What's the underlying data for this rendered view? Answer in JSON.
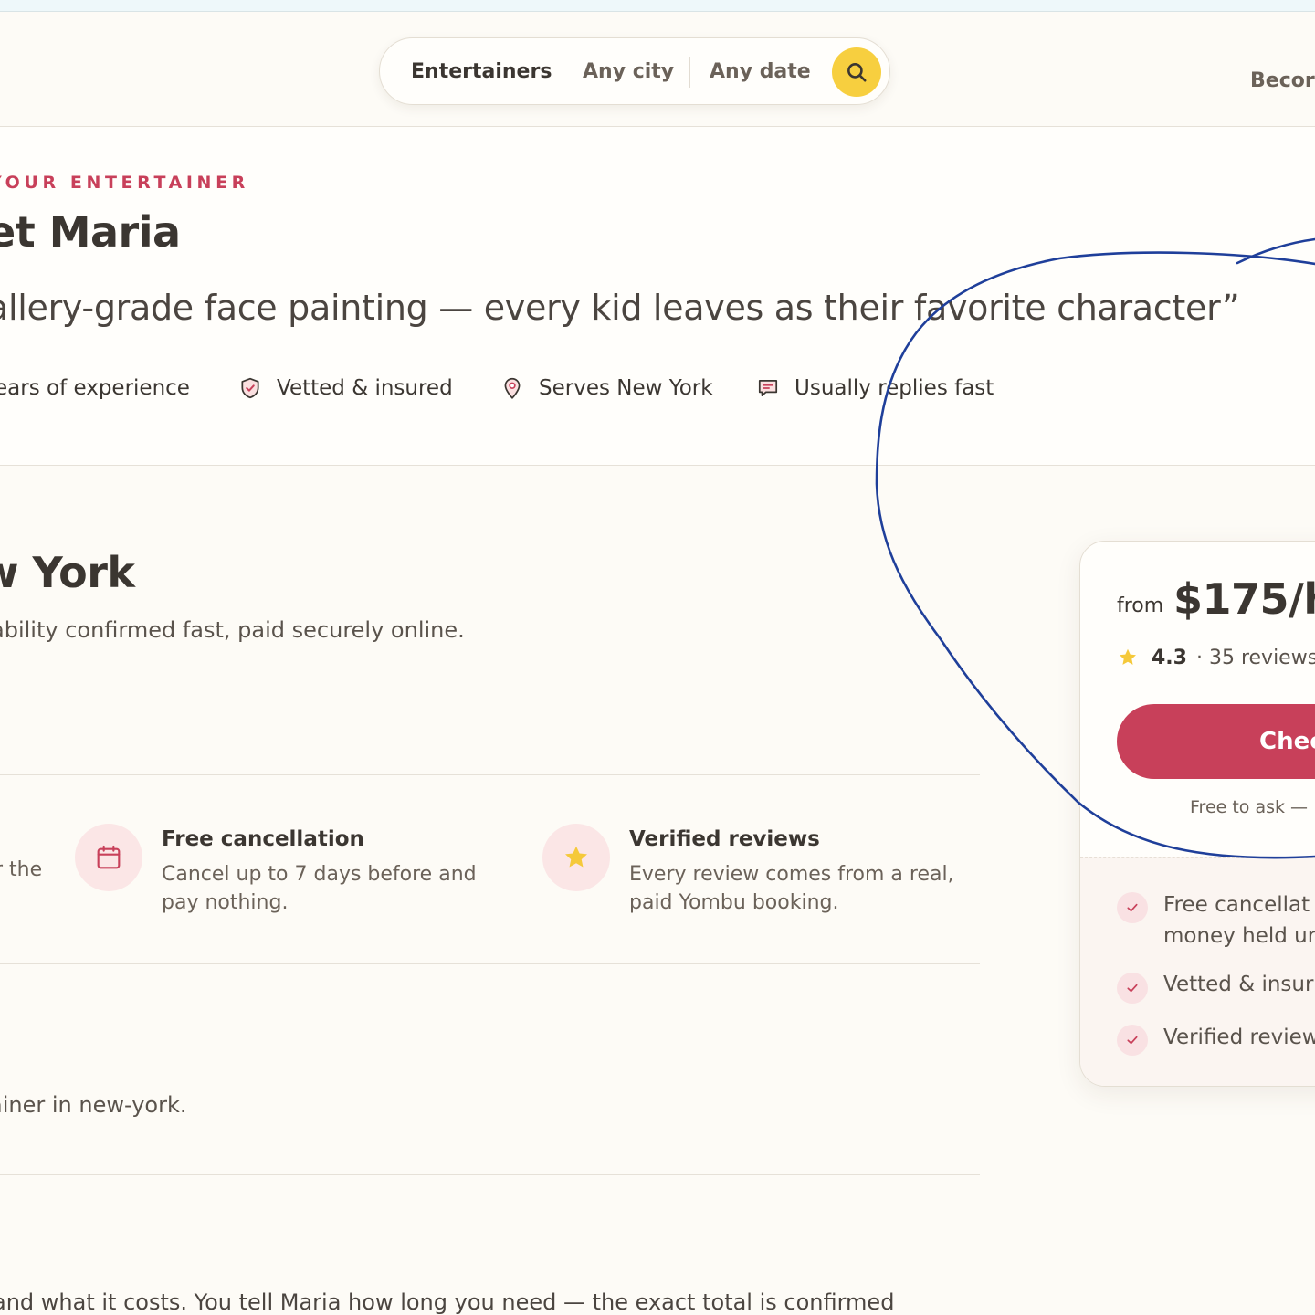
{
  "search": {
    "category": "Entertainers",
    "city": "Any city",
    "date": "Any date"
  },
  "nav": {
    "become_label": "Becor"
  },
  "hero": {
    "eyebrow": "YOUR ENTERTAINER",
    "name": "et Maria",
    "tagline": "allery-grade face painting — every kid leaves as their favorite character”",
    "facts": [
      {
        "label": "ears of experience",
        "icon": "none"
      },
      {
        "label": "Vetted & insured",
        "icon": "shield-check-icon"
      },
      {
        "label": "Serves New York",
        "icon": "map-pin-icon"
      },
      {
        "label": "Usually replies fast",
        "icon": "chat-bubble-icon"
      }
    ]
  },
  "city_section": {
    "heading": "w York",
    "subtitle": "ability confirmed fast, paid securely online."
  },
  "trust": {
    "partial_text": "r the",
    "items": [
      {
        "title": "Free cancellation",
        "desc": "Cancel up to 7 days before and pay nothing.",
        "icon": "calendar-icon"
      },
      {
        "title": "Verified reviews",
        "desc": "Every review comes from a real, paid Yombu booking.",
        "icon": "star-icon"
      }
    ]
  },
  "keyword_line": "ainer in new-york.",
  "bottom_text": "and what it costs. You tell Maria how long you need — the exact total is confirmed",
  "booking": {
    "from": "from",
    "price": "$175/h",
    "rating": "4.3",
    "reviews": "· 35 reviews",
    "cta": "Chec",
    "free_note": "Free to ask —",
    "checks": [
      {
        "line1": "Free cancellat",
        "line2": "money held ur"
      },
      {
        "line1": "Vetted & insur"
      },
      {
        "line1": "Verified review"
      }
    ]
  },
  "colors": {
    "accent": "#c8405a",
    "search_button": "#f7cf3f",
    "background": "#fdfbf6",
    "annotation": "#1f3f9a"
  }
}
